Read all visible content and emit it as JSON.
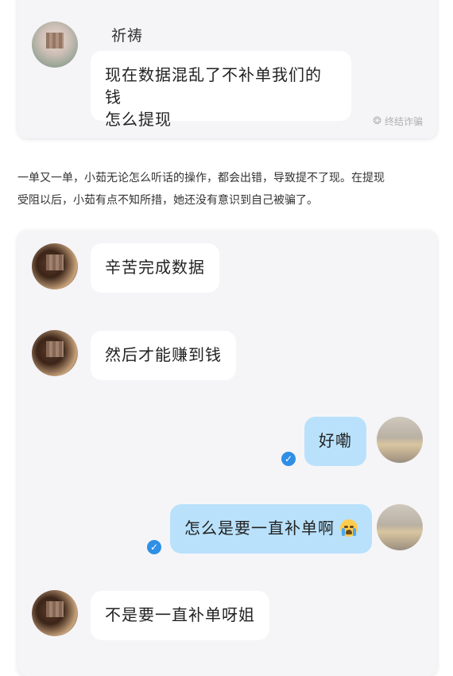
{
  "top_chat": {
    "sender_name": "祈祷",
    "message": [
      "现在数据混乱了不补单我们的钱",
      "怎么提现"
    ],
    "watermark": "终结诈骗",
    "watermark_icon": "wechat-icon"
  },
  "paragraph": [
    "一单又一单，小茹无论怎么听话的操作，都会出错，导致提不了现。在提现",
    "受阻以后，小茹有点不知所措，她还没有意识到自己被骗了。"
  ],
  "chat": {
    "messages": [
      {
        "side": "left",
        "text": "辛苦完成数据"
      },
      {
        "side": "left",
        "text": "然后才能赚到钱"
      },
      {
        "side": "right",
        "text": "好嘞",
        "read": true
      },
      {
        "side": "right",
        "text": "怎么是要一直补单啊",
        "emoji": "crying-face-icon",
        "read": true
      },
      {
        "side": "left",
        "text": "不是要一直补单呀姐"
      }
    ]
  },
  "colors": {
    "bubble_me": "#b9e1fb",
    "bubble_other": "#ffffff",
    "card_bg": "#f5f5f8",
    "read_check": "#2f8fe6"
  }
}
